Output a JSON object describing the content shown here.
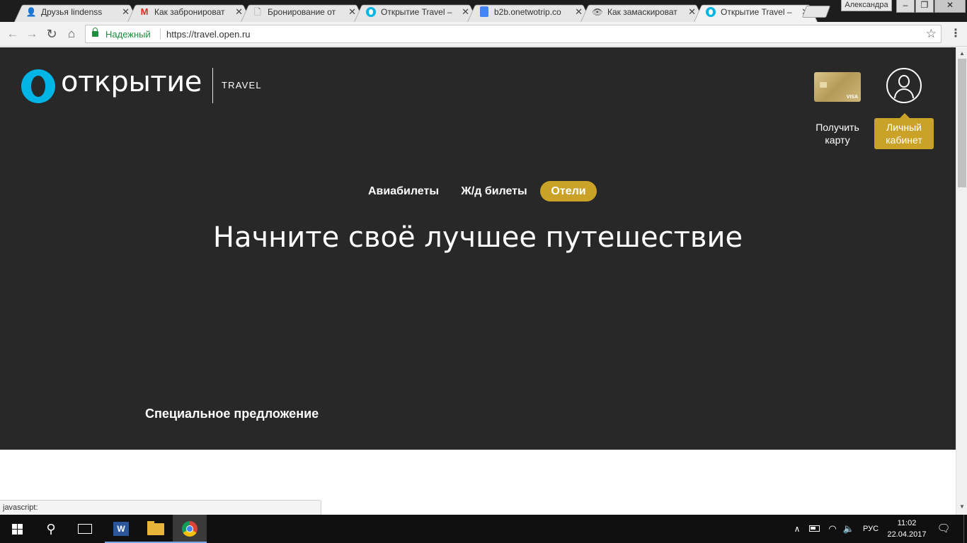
{
  "browser": {
    "tabs": [
      {
        "title": "Друзья lindenss",
        "icon": "user-icon",
        "active": false
      },
      {
        "title": "Как забронироват",
        "icon": "gmail-icon",
        "active": false
      },
      {
        "title": "Бронирование от",
        "icon": "document-icon",
        "active": false
      },
      {
        "title": "Открытие Travel –",
        "icon": "otkritie-icon",
        "active": false
      },
      {
        "title": "b2b.onetwotrip.co",
        "icon": "google-docs-icon",
        "active": false
      },
      {
        "title": "Как замаскироват",
        "icon": "eye-icon",
        "active": false
      },
      {
        "title": "Открытие Travel –",
        "icon": "otkritie-icon",
        "active": true
      }
    ],
    "close_glyph": "✕",
    "profile_name": "Александра",
    "window_buttons": {
      "minimize": "–",
      "maximize": "❐",
      "close": "✕"
    },
    "secure_label": "Надежный",
    "url": "https://travel.open.ru",
    "status_text": "javascript:"
  },
  "site": {
    "logo_text": "ОТКРЫТИЕ",
    "logo_subtitle": "TRAVEL",
    "get_card_label": "Получить карту",
    "card_brand": "VISA",
    "cabinet_label": "Личный кабинет",
    "nav_tabs": [
      {
        "label": "Авиабилеты",
        "active": false
      },
      {
        "label": "Ж/д билеты",
        "active": false
      },
      {
        "label": "Отели",
        "active": true
      }
    ],
    "headline": "Начните своё лучшее путешествие",
    "special_offer": "Специальное предложение",
    "colors": {
      "hero_bg": "#282828",
      "accent_gold": "#c9a227",
      "brand_blue": "#00b4e6"
    }
  },
  "taskbar": {
    "apps": [
      {
        "name": "Word",
        "glyph": "W"
      },
      {
        "name": "File Explorer"
      },
      {
        "name": "Google Chrome"
      }
    ],
    "language": "РУС",
    "time": "11:02",
    "date": "22.04.2017"
  }
}
